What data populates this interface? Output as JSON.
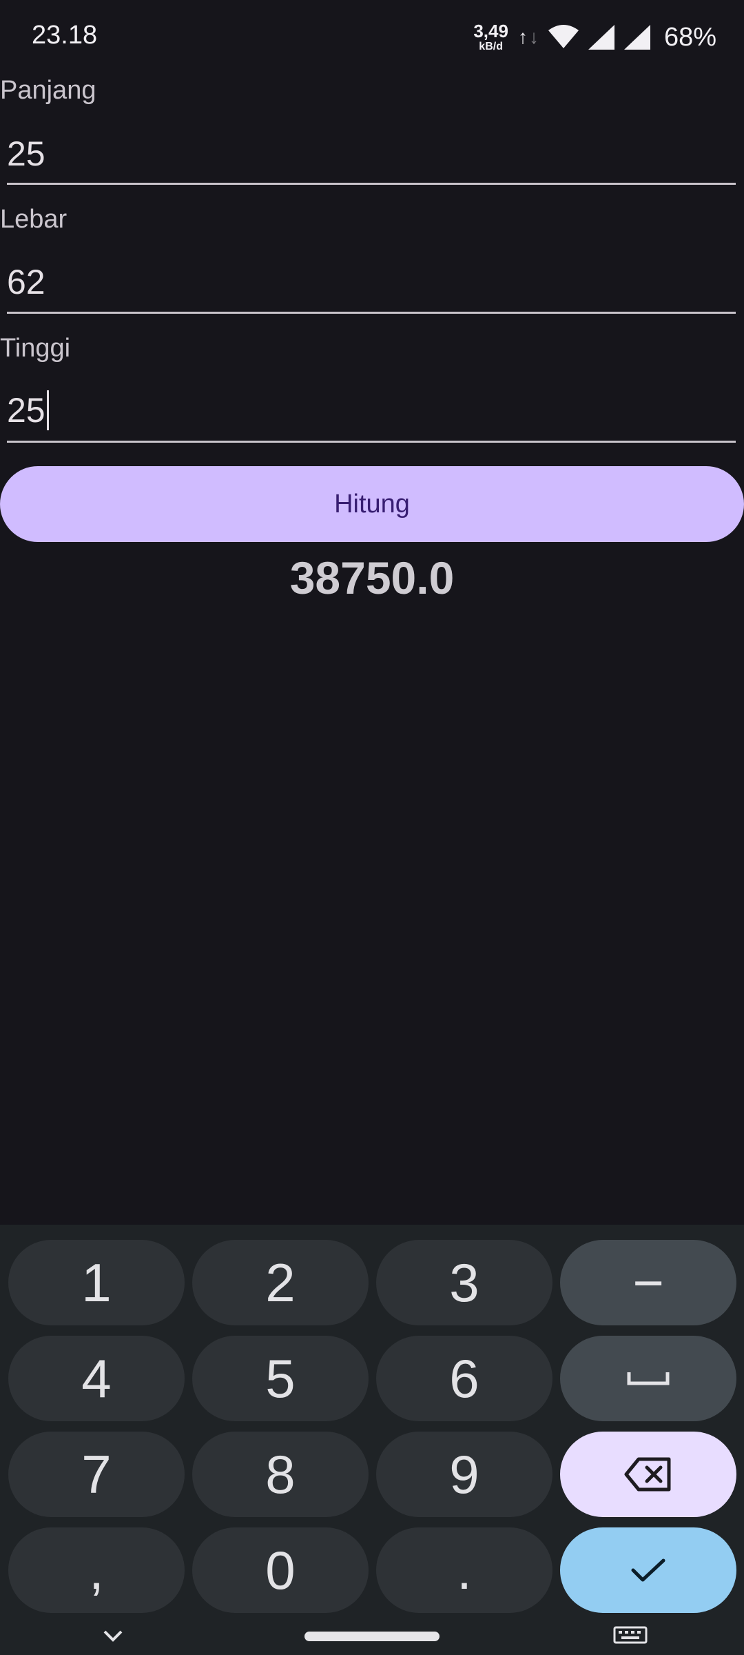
{
  "status": {
    "time": "23.18",
    "net_speed_value": "3,49",
    "net_speed_unit": "kB/d",
    "battery": "68%"
  },
  "form": {
    "panjang": {
      "label": "Panjang",
      "value": "25"
    },
    "lebar": {
      "label": "Lebar",
      "value": "62"
    },
    "tinggi": {
      "label": "Tinggi",
      "value": "25"
    }
  },
  "button": {
    "label": "Hitung"
  },
  "result": {
    "value": "38750.0"
  },
  "keyboard": {
    "keys": [
      "1",
      "2",
      "3",
      "−",
      "4",
      "5",
      "6",
      "7",
      "8",
      "9",
      ",",
      "0",
      "."
    ],
    "space_icon": "space-icon",
    "delete_icon": "backspace-icon",
    "enter_icon": "check-icon"
  },
  "colors": {
    "background": "#16151b",
    "button": "#d0bcff",
    "button_text": "#381e72",
    "keyboard_bg": "#1f2326",
    "key": "#2e3236",
    "key_fn": "#434a50",
    "key_delete": "#e8ddff",
    "key_enter": "#93cdf2"
  }
}
